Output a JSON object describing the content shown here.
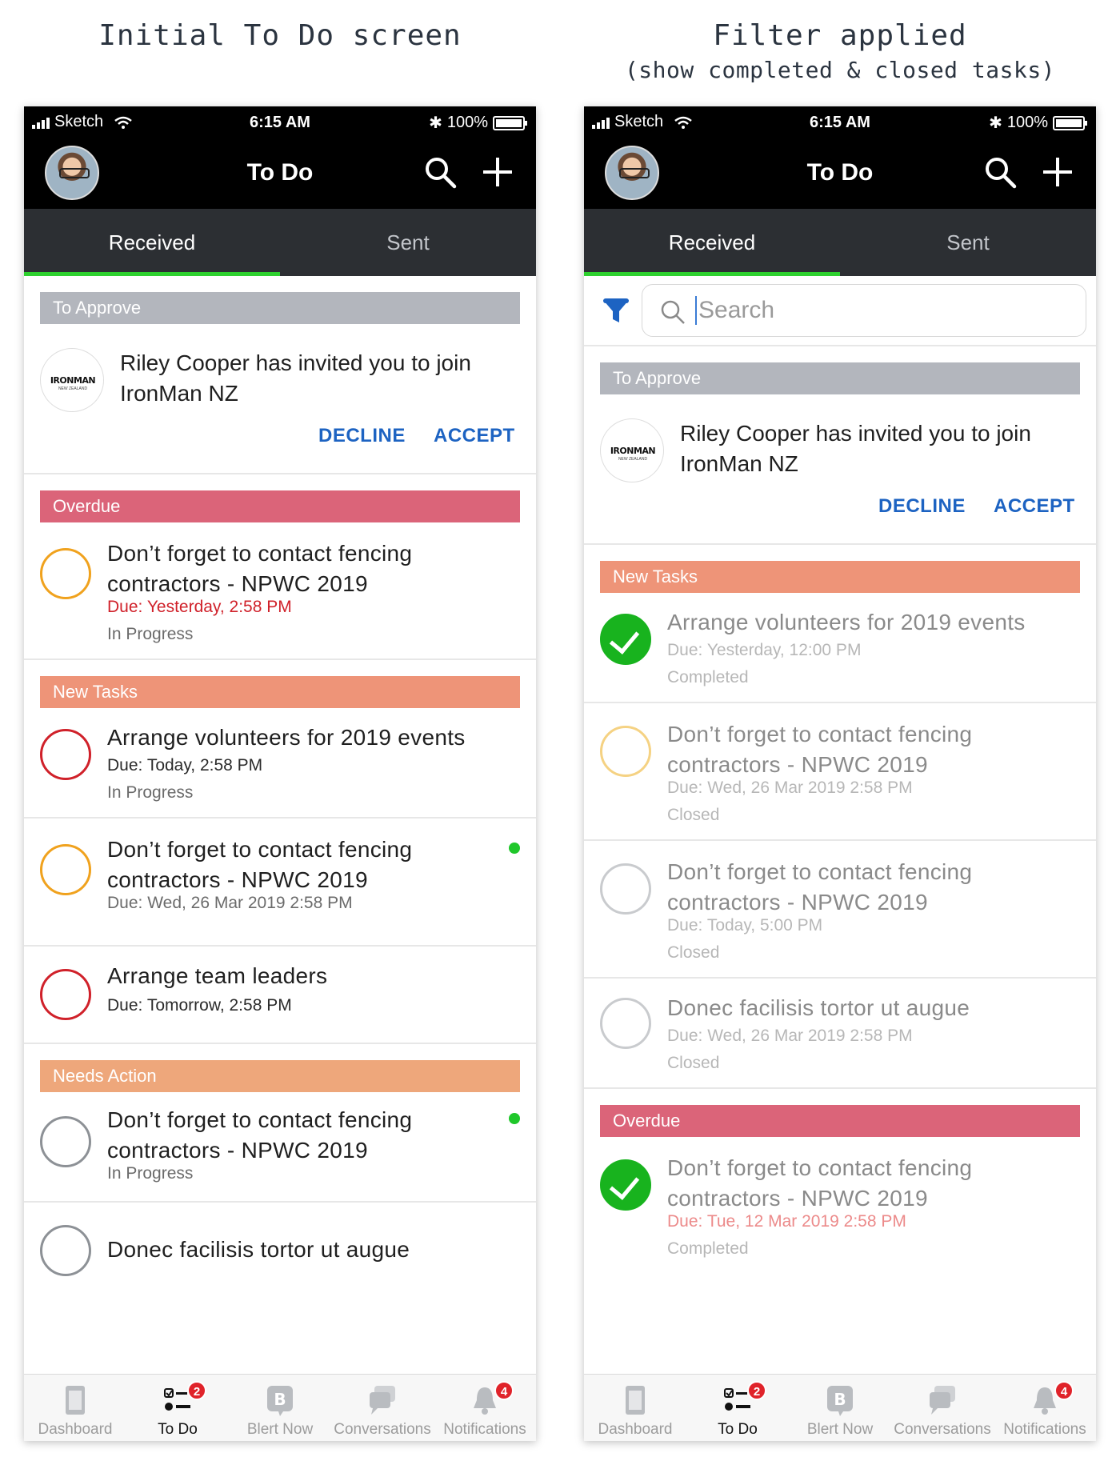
{
  "captions": {
    "left": "Initial To Do screen",
    "right_line1": "Filter applied",
    "right_line2": "(show completed & closed tasks)"
  },
  "status_bar": {
    "carrier": "Sketch",
    "time": "6:15 AM",
    "battery": "100%"
  },
  "nav": {
    "title": "To Do",
    "icons": [
      "avatar",
      "search-icon",
      "plus-icon"
    ]
  },
  "tabs": {
    "received": "Received",
    "sent": "Sent",
    "active": "Received"
  },
  "invite": {
    "inviter": "Riley Cooper",
    "message": "has invited you to join",
    "group": "IronMan NZ",
    "logo_text": "IRONMAN",
    "logo_subtext": "NEW ZEALAND",
    "decline": "DECLINE",
    "accept": "ACCEPT"
  },
  "sections": {
    "to_approve": "To Approve",
    "overdue": "Overdue",
    "new_tasks": "New Tasks",
    "needs_action": "Needs Action"
  },
  "left_tasks": [
    {
      "title": "Don’t forget to contact fencing contractors - NPWC 2019",
      "due": "Due: Yesterday, 2:58 PM",
      "status": "In Progress"
    },
    {
      "title": "Arrange volunteers for 2019 events",
      "due": "Due: Today, 2:58 PM",
      "status": "In Progress"
    },
    {
      "title": "Don’t forget to contact fencing contractors - NPWC 2019",
      "due": "Due: Wed, 26 Mar 2019 2:58 PM"
    },
    {
      "title": "Arrange team leaders",
      "due": "Due: Tomorrow, 2:58 PM"
    },
    {
      "title": "Don’t forget to contact fencing contractors - NPWC 2019",
      "status": "In Progress"
    },
    {
      "title": "Donec facilisis tortor ut augue"
    }
  ],
  "search": {
    "placeholder": "Search"
  },
  "right_tasks": [
    {
      "title": "Arrange volunteers for 2019 events",
      "due": "Due: Yesterday, 12:00 PM",
      "status": "Completed"
    },
    {
      "title": "Don’t forget to contact fencing contractors - NPWC 2019",
      "due": "Due: Wed, 26 Mar 2019 2:58 PM",
      "status": "Closed"
    },
    {
      "title": "Don’t forget to contact fencing contractors - NPWC 2019",
      "due": "Due: Today, 5:00 PM",
      "status": "Closed"
    },
    {
      "title": "Donec facilisis tortor ut augue",
      "due": "Due: Wed, 26 Mar 2019 2:58 PM",
      "status": "Closed"
    },
    {
      "title": "Don’t forget to contact fencing contractors - NPWC 2019",
      "due": "Due: Tue, 12 Mar 2019 2:58 PM",
      "status": "Completed"
    }
  ],
  "tabbar": {
    "dashboard": "Dashboard",
    "todo": "To Do",
    "todo_badge": "2",
    "blert_now": "Blert Now",
    "conversations": "Conversations",
    "notifications": "Notifications",
    "notifications_badge": "4",
    "active": "To Do"
  },
  "colors": {
    "to_approve": "#b3b6bd",
    "overdue": "#db6479",
    "new_tasks": "#ee9478",
    "needs_action": "#eea77b",
    "tab_indicator": "#2ed12e",
    "action_blue": "#1d63c2",
    "completed_green": "#18b31e",
    "unread_dot": "#1fc72a"
  }
}
